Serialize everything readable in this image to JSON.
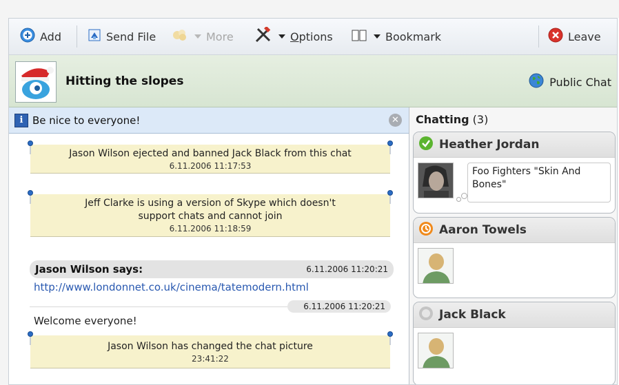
{
  "toolbar": {
    "add_label": "Add",
    "send_file_label": "Send File",
    "more_label": "More",
    "options_label": "Options",
    "bookmark_label": "Bookmark",
    "leave_label": "Leave"
  },
  "topic": {
    "title": "Hitting the slopes",
    "public_chat_label": "Public Chat"
  },
  "notice": {
    "text": "Be nice to everyone!"
  },
  "messages": {
    "sys1": {
      "text": "Jason Wilson ejected and banned Jack Black from this chat",
      "time": "6.11.2006 11:17:53"
    },
    "sys2": {
      "line1": "Jeff Clarke is using a version of Skype which doesn't",
      "line2": "support chats and cannot join",
      "time": "6.11.2006 11:18:59"
    },
    "says_header": "Jason Wilson says:",
    "says_time": "6.11.2006 11:20:21",
    "link": "http://www.londonnet.co.uk/cinema/tatemodern.html",
    "second_time": "6.11.2006 11:20:21",
    "welcome": "Welcome everyone!",
    "sys3": {
      "text": "Jason Wilson has changed the chat picture",
      "time": "23:41:22"
    }
  },
  "participants": {
    "heading": "Chatting",
    "count": "(3)",
    "list": [
      {
        "name": "Heather Jordan",
        "status": "online",
        "mood": "Foo Fighters \"Skin And Bones\""
      },
      {
        "name": "Aaron Towels",
        "status": "away"
      },
      {
        "name": "Jack Black",
        "status": "offline"
      }
    ]
  },
  "colors": {
    "online": "#5bb42f",
    "away": "#f08a1c",
    "offline": "#c4c4c4",
    "leave": "#d9322b",
    "link": "#2858b0"
  },
  "icons": [
    "add-icon",
    "send-file-icon",
    "more-icon",
    "options-tools-icon",
    "bookmark-book-icon",
    "leave-icon",
    "globe-icon",
    "info-icon",
    "close-icon"
  ]
}
